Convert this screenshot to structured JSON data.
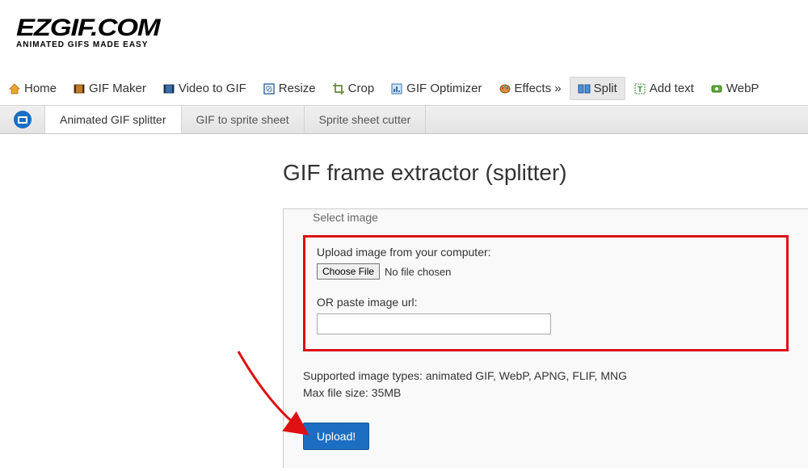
{
  "logo": {
    "main": "EZGIF.COM",
    "sub": "ANIMATED GIFS MADE EASY"
  },
  "nav": {
    "items": [
      {
        "label": "Home"
      },
      {
        "label": "GIF Maker"
      },
      {
        "label": "Video to GIF"
      },
      {
        "label": "Resize"
      },
      {
        "label": "Crop"
      },
      {
        "label": "GIF Optimizer"
      },
      {
        "label": "Effects »"
      },
      {
        "label": "Split"
      },
      {
        "label": "Add text"
      },
      {
        "label": "WebP"
      }
    ]
  },
  "subnav": {
    "tabs": [
      {
        "label": "Animated GIF splitter"
      },
      {
        "label": "GIF to sprite sheet"
      },
      {
        "label": "Sprite sheet cutter"
      }
    ]
  },
  "page": {
    "title": "GIF frame extractor (splitter)"
  },
  "form": {
    "legend": "Select image",
    "upload_label": "Upload image from your computer:",
    "choose_file": "Choose File",
    "file_status": "No file chosen",
    "or_label": "OR paste image url:",
    "url_value": "",
    "supported": "Supported image types: animated GIF, WebP, APNG, FLIF, MNG",
    "max_size": "Max file size: 35MB",
    "upload_btn": "Upload!"
  }
}
